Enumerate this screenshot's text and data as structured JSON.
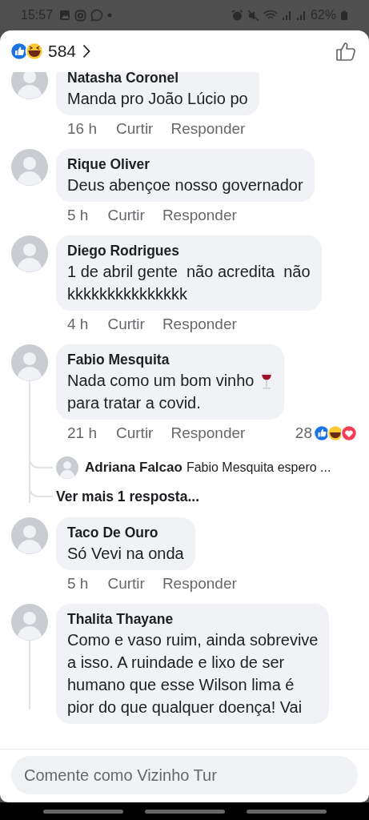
{
  "status_bar": {
    "time": "15:57",
    "battery": "62%"
  },
  "header": {
    "reaction_count": "584"
  },
  "comments": [
    {
      "name": "Natasha Coronel",
      "lines": [
        {
          "text": "Manda pro João Lúcio po"
        }
      ],
      "time": "16 h",
      "like_label": "Curtir",
      "reply_label": "Responder",
      "thread": false
    },
    {
      "name": "Rique Oliver",
      "lines": [
        {
          "text": "Deus abençoe nosso governador"
        }
      ],
      "time": "5 h",
      "like_label": "Curtir",
      "reply_label": "Responder",
      "thread": false
    },
    {
      "name": "Diego Rodrigues",
      "lines": [
        {
          "text": "1 de abril gente  não acredita  não"
        },
        {
          "text": "kkkkkkkkkkkkkkk"
        }
      ],
      "time": "4 h",
      "like_label": "Curtir",
      "reply_label": "Responder",
      "thread": false
    },
    {
      "name": "Fabio Mesquita",
      "lines": [
        {
          "text": "Nada como um bom vinho",
          "kind": "with_icon"
        },
        {
          "text": "para tratar a covid."
        }
      ],
      "time": "21 h",
      "like_label": "Curtir",
      "reply_label": "Responder",
      "reaction_count": "28",
      "thread": true,
      "replies": [
        {
          "name": "Adriana Falcao",
          "text": "Fabio Mesquita espero ..."
        }
      ],
      "more_replies": "Ver mais 1 resposta..."
    },
    {
      "name": "Taco De Ouro",
      "lines": [
        {
          "text": "Só Vevi na onda"
        }
      ],
      "time": "5 h",
      "like_label": "Curtir",
      "reply_label": "Responder",
      "thread": false
    },
    {
      "name": "Thalita Thayane",
      "lines": [
        {
          "text": "Como e vaso ruim, ainda sobrevive"
        },
        {
          "text": "a isso. A ruindade e lixo de ser"
        },
        {
          "text": "humano que esse Wilson lima é"
        },
        {
          "text": "pior do que qualquer doença! Vai"
        }
      ],
      "thread": true
    }
  ],
  "composer": {
    "placeholder": "Comente como Vizinho Tur"
  }
}
